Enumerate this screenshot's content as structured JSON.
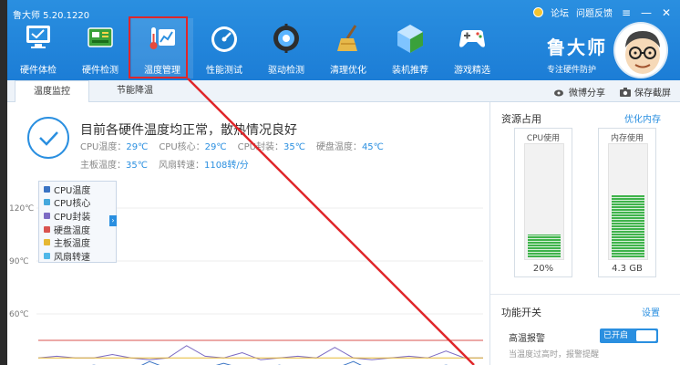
{
  "app": {
    "title": "鲁大师 5.20.1220"
  },
  "title_links": {
    "forum": "论坛",
    "feedback": "问题反馈"
  },
  "window_buttons": {
    "skin": "≡",
    "min": "—",
    "close": "✕"
  },
  "nav": [
    {
      "label": "硬件体检",
      "icon": "monitor-check-icon"
    },
    {
      "label": "硬件检测",
      "icon": "circuit-board-icon"
    },
    {
      "label": "温度管理",
      "icon": "thermometer-chart-icon"
    },
    {
      "label": "性能测试",
      "icon": "speedometer-icon"
    },
    {
      "label": "驱动检测",
      "icon": "driver-gear-icon"
    },
    {
      "label": "清理优化",
      "icon": "broom-icon"
    },
    {
      "label": "装机推荐",
      "icon": "cube-icon"
    },
    {
      "label": "游戏精选",
      "icon": "gamepad-icon"
    }
  ],
  "brand": {
    "name": "鲁大师",
    "slogan": "专注硬件防护"
  },
  "tabs": {
    "temp_monitor": "温度监控",
    "energy_saving": "节能降温"
  },
  "tab_actions": {
    "weibo_share": "微博分享",
    "save_screenshot": "保存截屏"
  },
  "status": {
    "title": "目前各硬件温度均正常，散热情况良好",
    "row1": [
      {
        "label": "CPU温度：",
        "value": "29℃"
      },
      {
        "label": "CPU核心：",
        "value": "29℃"
      },
      {
        "label": "CPU封装：",
        "value": "35℃"
      },
      {
        "label": "硬盘温度：",
        "value": "45℃"
      }
    ],
    "row2": [
      {
        "label": "主板温度：",
        "value": "35℃"
      },
      {
        "label": "风扇转速：",
        "value": "1108转/分"
      }
    ]
  },
  "legend": [
    {
      "label": "CPU温度",
      "color": "#3a74c4"
    },
    {
      "label": "CPU核心",
      "color": "#45a8dc"
    },
    {
      "label": "CPU封装",
      "color": "#7c6bc4"
    },
    {
      "label": "硬盘温度",
      "color": "#d9534f"
    },
    {
      "label": "主板温度",
      "color": "#e6b832"
    },
    {
      "label": "风扇转速",
      "color": "#50b8e8"
    }
  ],
  "legend_toggle": "›",
  "chart_data": {
    "type": "line",
    "y_ticks": [
      "120℃",
      "90℃",
      "60℃"
    ],
    "series": [
      {
        "name": "硬盘温度",
        "values": [
          45,
          45,
          45,
          45,
          45,
          45,
          45,
          45,
          45,
          45,
          45,
          45,
          45,
          45,
          45,
          45,
          45,
          45,
          45,
          45,
          45,
          45,
          45,
          45,
          45
        ]
      },
      {
        "name": "CPU封装",
        "values": [
          35,
          36,
          35,
          35,
          37,
          35,
          34,
          35,
          42,
          36,
          35,
          38,
          34,
          35,
          36,
          35,
          41,
          35,
          34,
          35,
          36,
          35,
          39,
          35,
          35
        ]
      },
      {
        "name": "主板温度",
        "values": [
          35,
          35,
          35,
          35,
          35,
          35,
          35,
          35,
          35,
          35,
          35,
          35,
          35,
          35,
          35,
          35,
          35,
          35,
          35,
          35,
          35,
          35,
          35,
          35,
          35
        ]
      },
      {
        "name": "CPU温度",
        "values": [
          29,
          30,
          29,
          31,
          29,
          28,
          33,
          29,
          30,
          29,
          32,
          29,
          28,
          31,
          29,
          30,
          29,
          33,
          28,
          29,
          30,
          29,
          31,
          29,
          29
        ]
      }
    ]
  },
  "sidebar": {
    "resources_title": "资源占用",
    "optimize_memory": "优化内存",
    "cpu": {
      "label": "CPU使用",
      "value": "20%",
      "fill": 0.2
    },
    "memory": {
      "label": "内存使用",
      "value": "4.3 GB",
      "fill": 0.55
    },
    "features_title": "功能开关",
    "settings": "设置",
    "alarm_label": "高温报警",
    "alarm_state": "已开启",
    "alarm_desc": "当温度过高时，报警提醒"
  },
  "colors": {
    "primary": "#2a8fe0",
    "annotation": "#e0262a",
    "bar": "#3fb34b"
  }
}
